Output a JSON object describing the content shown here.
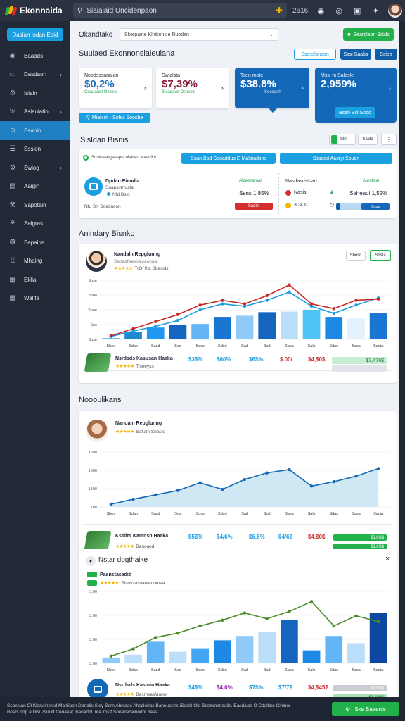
{
  "app": {
    "title": "Ekonnaida",
    "colors": {
      "blue": "#1a9fe0",
      "green": "#22b04b",
      "red": "#d32f2f",
      "navy": "#0f5fa8",
      "dark": "#222a37"
    }
  },
  "topbar": {
    "search_text": "Siaiaiaid Uncidenpaon",
    "time": "2616",
    "icons": [
      "grid-icon",
      "plus-icon",
      "clock-icon",
      "target-icon",
      "bag-icon",
      "fork-icon"
    ]
  },
  "sidebar": {
    "primary_button": "Dasian Isdan Edid",
    "items": [
      {
        "label": "Baaads",
        "icon": "circle-icon",
        "chevron": false
      },
      {
        "label": "Dasdaon",
        "icon": "monitor-icon",
        "chevron": true
      },
      {
        "label": "Isiain",
        "icon": "cog-icon",
        "chevron": false
      },
      {
        "label": "Asiaulatio",
        "icon": "shield-icon",
        "chevron": true
      },
      {
        "label": "Ssanin",
        "icon": "user-icon",
        "chevron": false
      },
      {
        "label": "Sssion",
        "icon": "list-icon",
        "chevron": false
      },
      {
        "label": "Swiog",
        "icon": "gear-icon",
        "chevron": true
      },
      {
        "label": "Aaigin",
        "icon": "doc-icon",
        "chevron": false
      },
      {
        "label": "Sapotain",
        "icon": "wrench-icon",
        "chevron": false
      },
      {
        "label": "Saigras",
        "icon": "users-icon",
        "chevron": false
      },
      {
        "label": "Sapaina",
        "icon": "cog2-icon",
        "chevron": false
      },
      {
        "label": "Mhaing",
        "icon": "person-icon",
        "chevron": false
      },
      {
        "label": "Eklia",
        "icon": "chart-icon",
        "chevron": false
      },
      {
        "label": "Wallfa",
        "icon": "grid-icon",
        "chevron": false
      }
    ]
  },
  "header": {
    "title": "Okandtako",
    "select_value": "Skerpaine Klnikonsle Ruodan",
    "action_button": "Seardlaon Sdals"
  },
  "overview": {
    "title": "Suulaed Ekonnonsiaieulana",
    "buttons": [
      "Ssdsslsndon",
      "Sssi Saabs",
      "Ssiea"
    ],
    "stats": [
      {
        "label": "Noodsssarialan",
        "value": "$0,2%",
        "sub": "Cnaaarolt Onissls"
      },
      {
        "label": "Swialsta",
        "value": "$7,39%",
        "sub": "Sicadaus Osnvolt"
      },
      {
        "label": "Tseu mote",
        "value": "$38.8%",
        "sub": "Seosdoh"
      },
      {
        "label": "Mssi m Salasle",
        "value": "2,959%",
        "sub": "",
        "button": "Bseh Ssi Sodo"
      }
    ],
    "link_button": "Mian m - Sofiul Soosbe"
  },
  "business": {
    "title": "Sisldan Bisnis",
    "toggle": [
      "Sbl",
      "Saida"
    ],
    "bar_text": "Snsknaasgasspucaiskteo Maaniior",
    "bar_buttons": [
      "Ssan Bad Sooaddus E Malaiadsns",
      "Sssoad Aasryi Spudn"
    ],
    "left": {
      "name": "Dpdan Eiendia",
      "sub": "Saapsstrtuala",
      "meta": "Nfd Bsio",
      "tag": "Aldaenamal",
      "pct": "Ssns 1,85%",
      "pill": "Sadlis",
      "footer": "Nfu Srr Boaducon"
    },
    "right": {
      "title": "Nasdasdstdan",
      "tag": "Aurolstal",
      "row1": "Nasis",
      "row1_val": "Saheadi 1,52%",
      "row2": "3 3/JC",
      "pill": "Saus"
    }
  },
  "section2": {
    "title": "Anindary Bisnko"
  },
  "section3": {
    "title": "Noooulikans"
  },
  "panels": [
    {
      "name": "Nandaln Repglunng",
      "sub": "Sadaafaasbaisaenaal",
      "rating": "TrOf lha Sbasids",
      "buttons": [
        "Sbosn",
        "Sdsta"
      ],
      "product": {
        "name": "Nsrdsds Kasusan Haaka",
        "rating": "Tiseeyss",
        "vals": [
          "$3$%",
          "$60%",
          "$6$%",
          "$.00/",
          "$4,$0$",
          "$3,476$"
        ]
      }
    },
    {
      "name": "Nandaln Repglunng",
      "sub": "",
      "rating": "Saf'aln Sbasls",
      "product": {
        "name": "Kssiits Kamnsn Haaka",
        "rating": "Banoaed",
        "vals": [
          "$5$%",
          "$4/6%",
          "$6,5%",
          "$4/6$",
          "$4,$0$",
          "$3,8S$",
          "$3,8S$"
        ]
      }
    },
    {
      "name": "Nstar dogthaike",
      "sub": "Pasnstasadid",
      "rating": "Sisossasuanteoomaa",
      "product": {
        "name": "Nsrdsds Kasmin Haaka",
        "rating": "Besmsasfannet",
        "vals": [
          "$4$%",
          "$4,0%",
          "$7$%",
          "$7/7$",
          "$4,$45$",
          "$3,8S$",
          "$3,456$"
        ]
      }
    }
  ],
  "chart_data": [
    {
      "type": "bar",
      "categories": [
        "Sbes",
        "Sdao",
        "Sasd",
        "Sos",
        "Sdss",
        "Sdsd",
        "Sad",
        "Sod",
        "Sasa",
        "Sals",
        "Sdas",
        "Sasa",
        "Sadia"
      ],
      "series": [
        {
          "name": "",
          "type": "bar",
          "values": [
            2,
            12,
            20,
            25,
            26,
            38,
            40,
            46,
            47,
            50,
            38,
            36,
            44
          ]
        },
        {
          "name": "",
          "type": "line",
          "values": [
            5,
            14,
            22,
            32,
            50,
            60,
            56,
            66,
            80,
            56,
            44,
            58,
            70
          ]
        },
        {
          "name": "",
          "type": "line",
          "values": [
            6,
            18,
            30,
            42,
            58,
            66,
            60,
            74,
            92,
            60,
            52,
            66,
            68
          ]
        }
      ],
      "yticks": [
        "Sose",
        "3ouo",
        "Sone",
        "Sns",
        "Suse"
      ],
      "ylim": [
        0,
        100
      ]
    },
    {
      "type": "line",
      "categories": [
        "Sbes",
        "Sdao",
        "Sasd",
        "Sos",
        "Sdss",
        "Sdsd",
        "Sad",
        "Sod",
        "Sasa",
        "Sals",
        "Sdas",
        "Sasa",
        "Sadia"
      ],
      "series": [
        {
          "name": "",
          "values": [
            5,
            14,
            22,
            30,
            44,
            32,
            50,
            62,
            68,
            38,
            46,
            56,
            70
          ]
        }
      ],
      "yticks": [
        "1500",
        "1500",
        "1500",
        "108"
      ],
      "ylim": [
        0,
        100
      ]
    },
    {
      "type": "bar",
      "categories": [
        "Sbes",
        "Sdao",
        "Sasd",
        "Sos",
        "Sdss",
        "Sdsd",
        "Sad",
        "Sod",
        "Sasa",
        "Sals",
        "Sdas",
        "Sasa",
        "Sadia"
      ],
      "series": [
        {
          "name": "",
          "type": "bar",
          "values": [
            8,
            12,
            30,
            16,
            20,
            32,
            38,
            44,
            60,
            18,
            38,
            28,
            70
          ]
        },
        {
          "name": "",
          "type": "line",
          "values": [
            10,
            20,
            36,
            42,
            52,
            60,
            70,
            62,
            72,
            86,
            52,
            66,
            58
          ]
        }
      ],
      "yticks": [
        "3,00",
        "3,00",
        "3,00",
        "3,00"
      ],
      "ylim": [
        0,
        100
      ]
    }
  ]
}
